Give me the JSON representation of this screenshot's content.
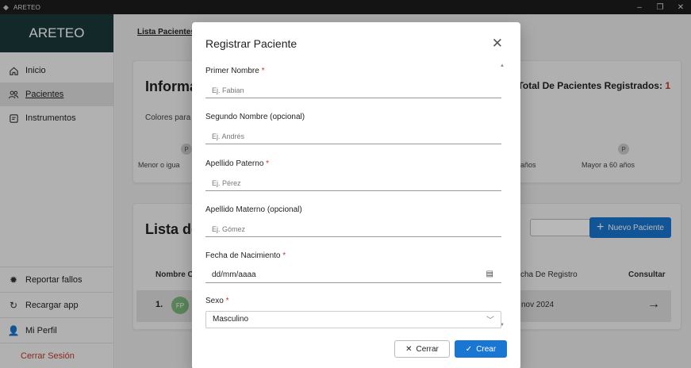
{
  "window": {
    "title": "ARETEO",
    "minimize": "–",
    "maximize": "❐",
    "close": "✕"
  },
  "sidebar": {
    "brand": "ARETEO",
    "items": [
      {
        "label": "Inicio",
        "icon": "home-icon"
      },
      {
        "label": "Pacientes",
        "icon": "users-icon"
      },
      {
        "label": "Instrumentos",
        "icon": "clipboard-icon"
      }
    ],
    "bottom": [
      {
        "label": "Reportar fallos",
        "icon": "bug-icon"
      },
      {
        "label": "Recargar app",
        "icon": "reload-icon"
      },
      {
        "label": "Mi Perfil",
        "icon": "user-icon"
      },
      {
        "label": "Cerrar Sesión",
        "icon": ""
      }
    ]
  },
  "main": {
    "breadcrumb": "Lista Pacientes",
    "info_card": {
      "title": "Informa",
      "total_label": "Total De Pacientes Registrados:",
      "total_value": "1",
      "colors_label": "Colores para",
      "dot_letter": "P",
      "range_left": "Menor o igua",
      "range_mid": "años",
      "range_right": "Mayor a 60 años"
    },
    "list_card": {
      "title": "Lista de",
      "new_button": "Nuevo Paciente",
      "columns": {
        "name": "Nombre C",
        "date": "cha De Registro",
        "consult": "Consultar"
      },
      "rows": [
        {
          "index": "1.",
          "initials": "FP",
          "date": "nov 2024"
        }
      ]
    }
  },
  "modal": {
    "title": "Registrar Paciente",
    "fields": [
      {
        "label": "Primer Nombre",
        "required": "*",
        "placeholder": "Ej. Fabian"
      },
      {
        "label": "Segundo Nombre (opcional)",
        "required": "",
        "placeholder": "Ej. Andrés"
      },
      {
        "label": "Apellido Paterno",
        "required": "*",
        "placeholder": "Ej. Pérez"
      },
      {
        "label": "Apellido Materno (opcional)",
        "required": "",
        "placeholder": "Ej. Gómez"
      },
      {
        "label": "Fecha de Nacimiento",
        "required": "*",
        "value": "dd/mm/aaaa"
      },
      {
        "label": "Sexo",
        "required": "*",
        "value": "Masculino"
      }
    ],
    "cancel_button": "Cerrar",
    "submit_button": "Crear"
  }
}
